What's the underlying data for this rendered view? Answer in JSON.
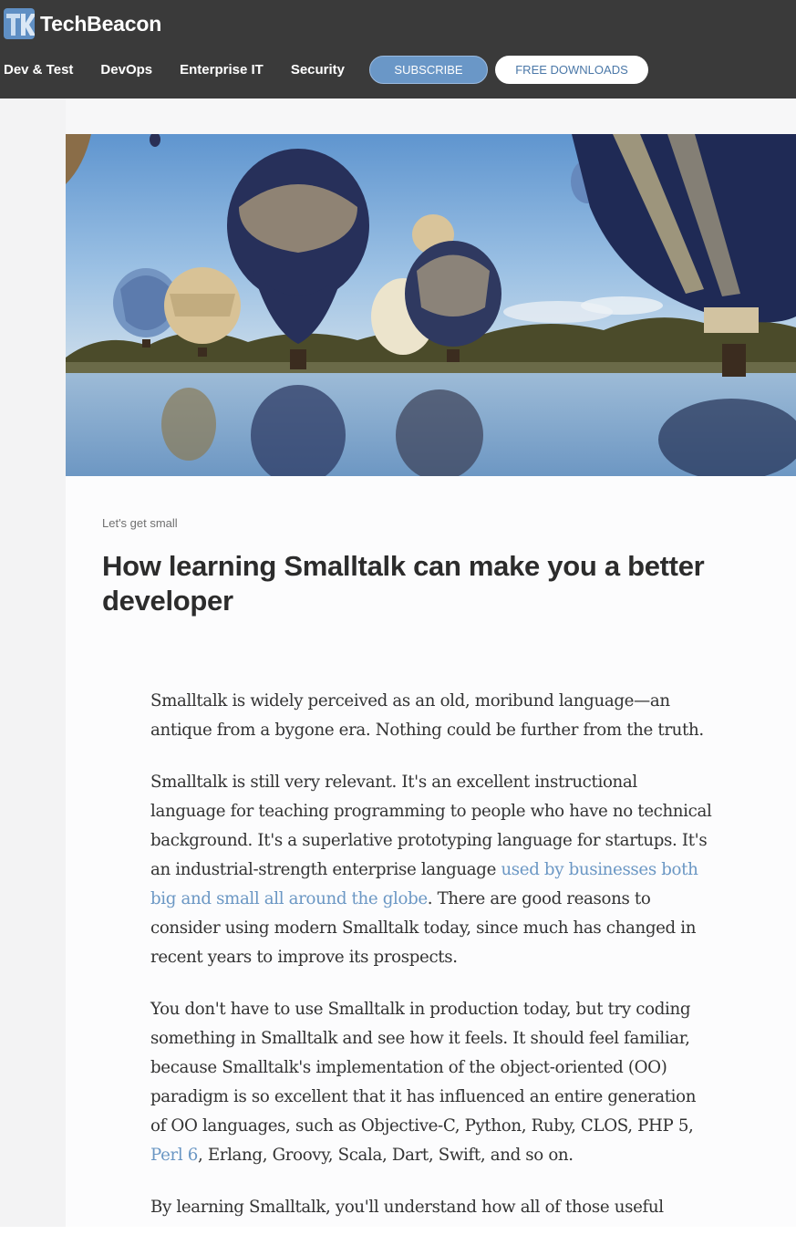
{
  "header": {
    "logo_text": "TechBeacon",
    "nav": [
      "Dev & Test",
      "DevOps",
      "Enterprise IT",
      "Security"
    ],
    "subscribe_label": "SUBSCRIBE",
    "free_downloads_label": "FREE DOWNLOADS"
  },
  "article": {
    "kicker": "Let's get small",
    "title": "How learning Smalltalk can make you a better developer",
    "p1": "Smalltalk is widely perceived as an old, moribund language—an antique from a bygone era. Nothing could be further from the truth.",
    "p2_a": "Smalltalk is still very relevant. It's an excellent instructional language for teaching programming to people who have no technical background. It's a superlative prototyping language for startups. It's an industrial-strength enterprise language ",
    "p2_link": "used by businesses both big and small all around the globe",
    "p2_b": ". There are good reasons to consider using modern Smalltalk today, since much has changed in recent years to improve its prospects.",
    "p3_a": "You don't have to use Smalltalk in production today, but try coding something in Smalltalk and see how it feels. It should feel familiar, because Smalltalk's implementation of the object-oriented (OO) paradigm is so excellent that it has influenced an entire generation of OO languages, such as Objective-C, Python, Ruby, CLOS, PHP 5, ",
    "p3_link": "Perl 6",
    "p3_b": ", Erlang, Groovy, Scala, Dart, Swift, and so on.",
    "p4": "By learning Smalltalk, you'll understand how all of those useful"
  },
  "colors": {
    "header_bg": "#3a3a3a",
    "accent_blue": "#6a97c7",
    "link": "#6b97c4"
  },
  "icons": {
    "logo": "techbeacon-tb-logo-icon"
  }
}
